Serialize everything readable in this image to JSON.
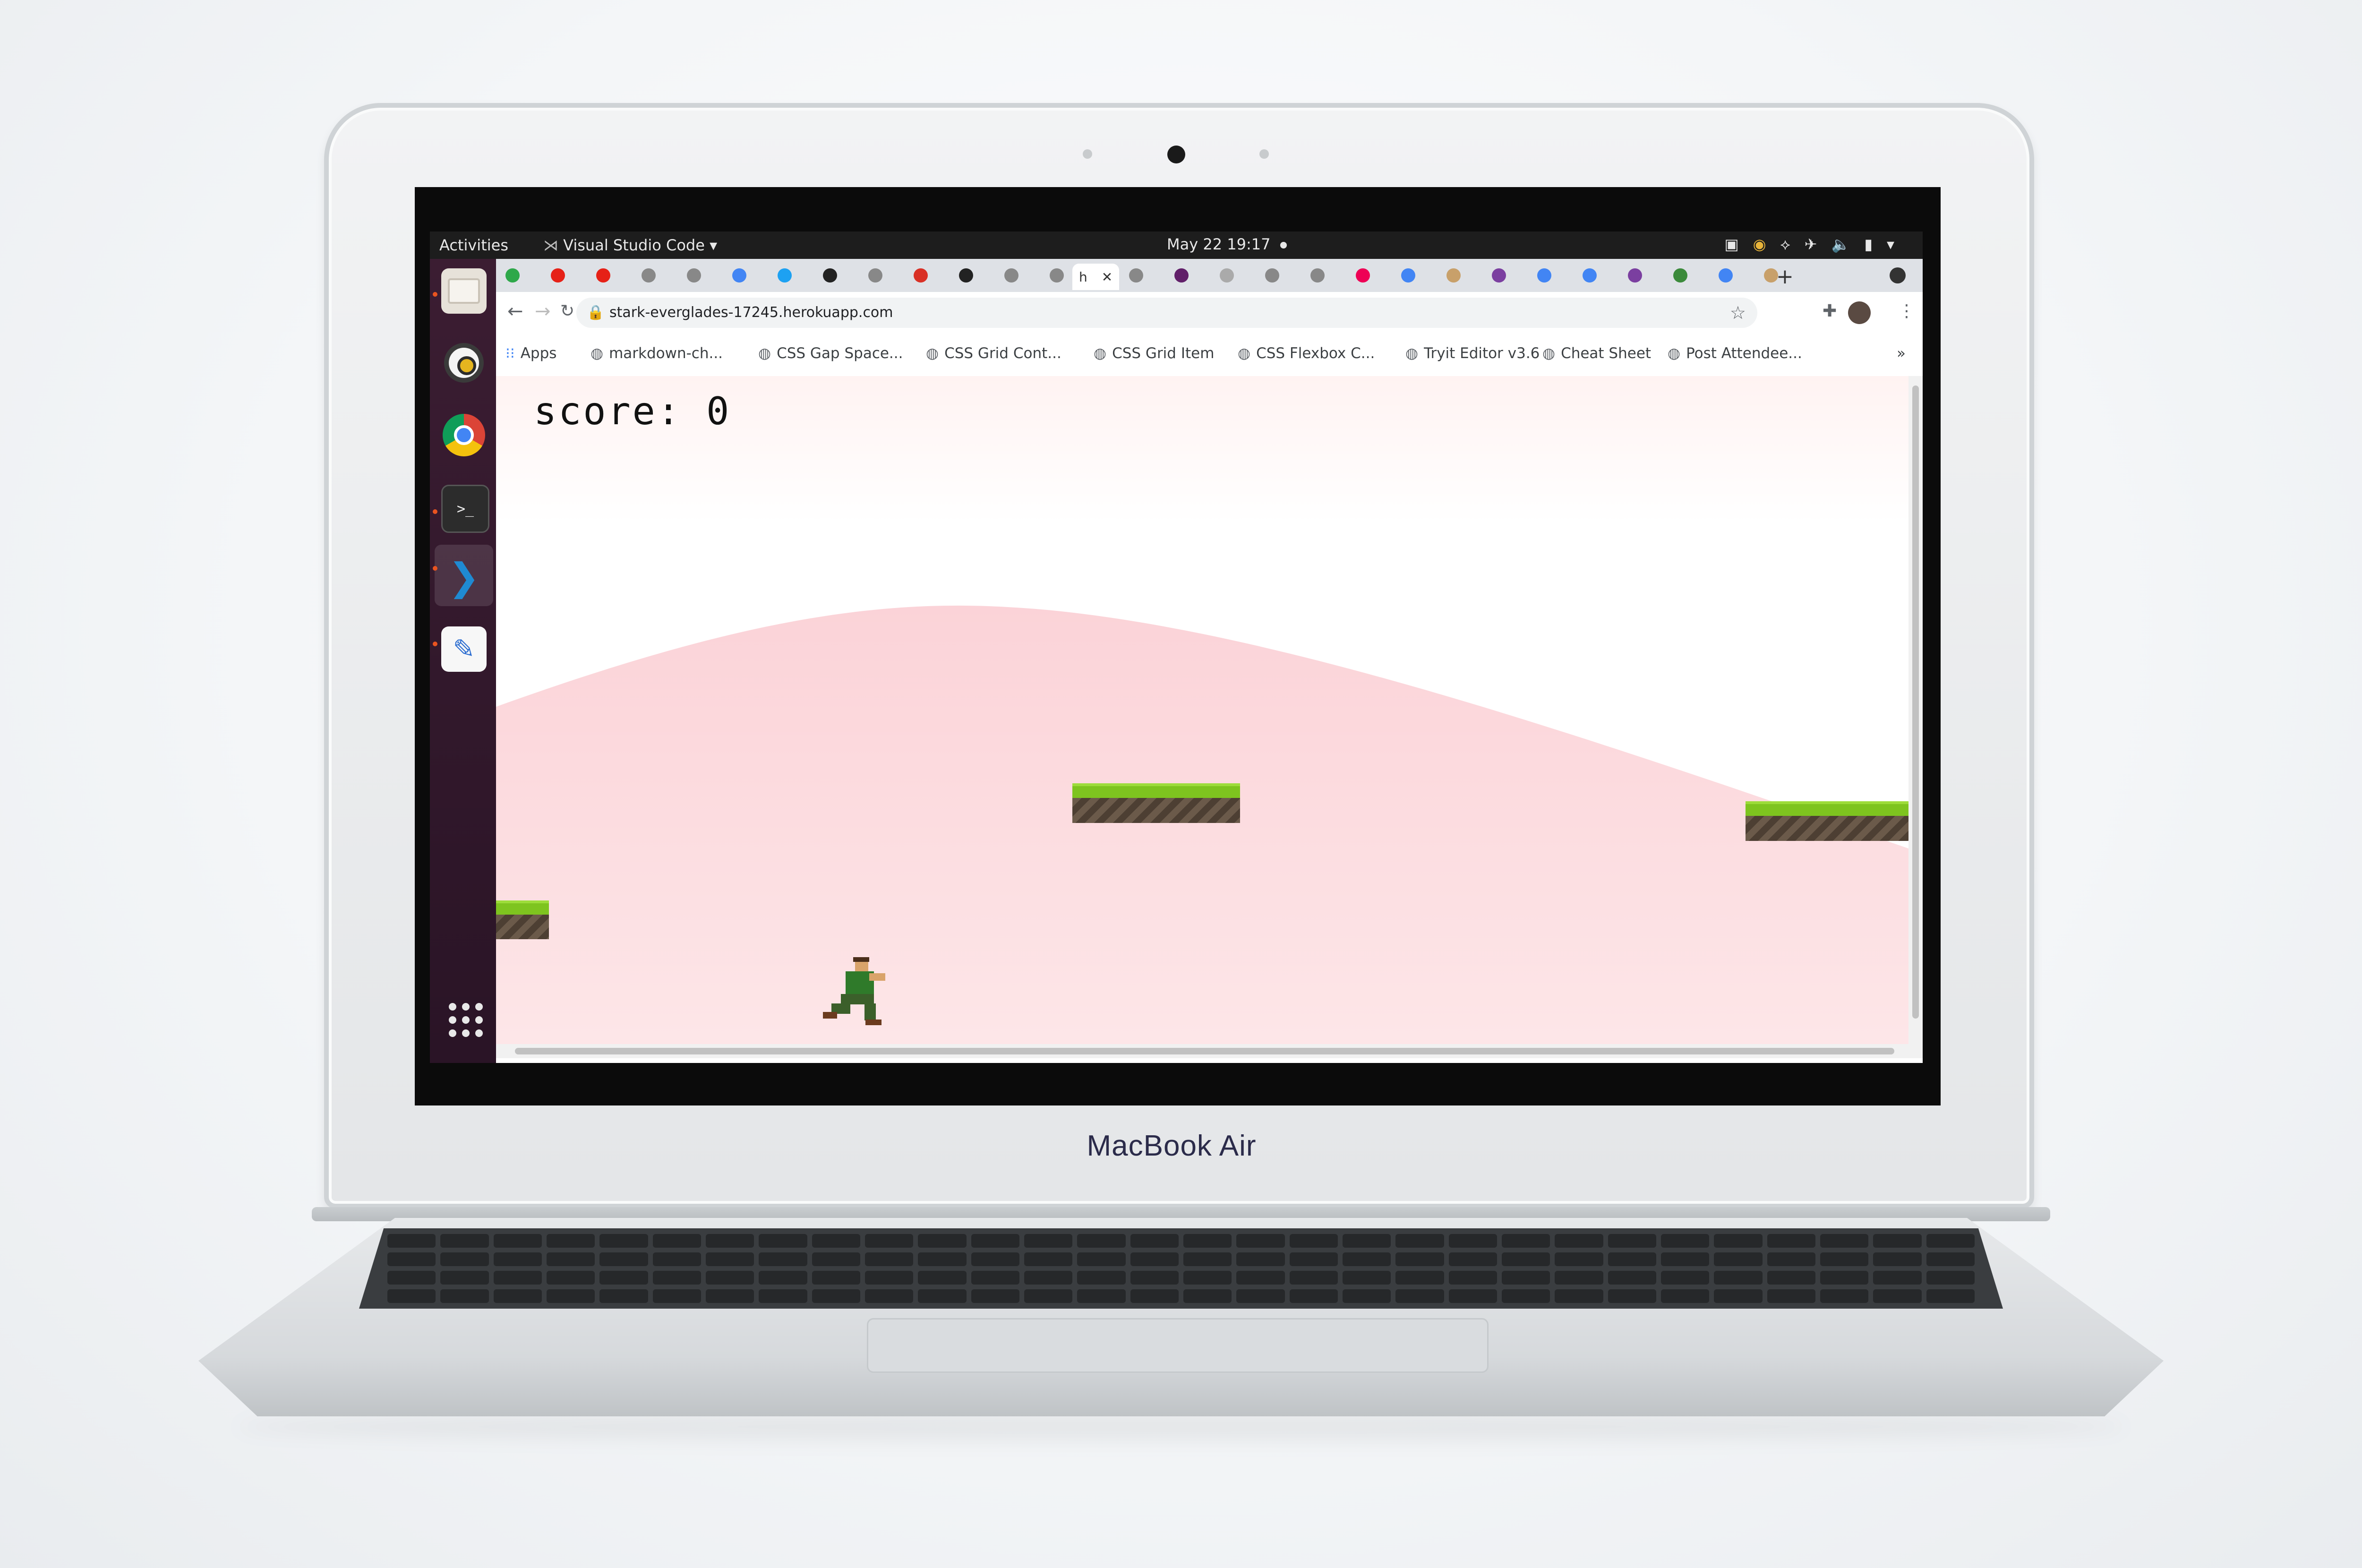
{
  "device": {
    "brand_label": "MacBook Air"
  },
  "desktop": {
    "topbar": {
      "activities": "Activities",
      "app_name": "Visual Studio Code ▾",
      "clock": "May 22  19:17"
    },
    "dock": {
      "items": [
        "files-icon",
        "rhythmbox-icon",
        "chrome-icon",
        "terminal-icon",
        "vscode-icon",
        "text-editor-icon"
      ],
      "show_apps": "apps-grid-icon"
    }
  },
  "browser": {
    "new_tab": "+",
    "active_tab_label": "h",
    "active_tab_close": "✕",
    "url": "stark-everglades-17245.herokuapp.com",
    "bookmarks": [
      {
        "label": "Apps"
      },
      {
        "label": "markdown-ch..."
      },
      {
        "label": "CSS Gap Space..."
      },
      {
        "label": "CSS Grid Cont..."
      },
      {
        "label": "CSS Grid Item"
      },
      {
        "label": "CSS Flexbox C..."
      },
      {
        "label": "Tryit Editor v3.6"
      },
      {
        "label": "Cheat Sheet"
      },
      {
        "label": "Post Attendee..."
      }
    ],
    "bookmarks_overflow": "»"
  },
  "game": {
    "score_text": "score:  0",
    "colors": {
      "hill": "#fdd8dd",
      "grass": "#7ec41f",
      "dirt": "#5b4a3c",
      "sky": "#ffffff"
    }
  }
}
